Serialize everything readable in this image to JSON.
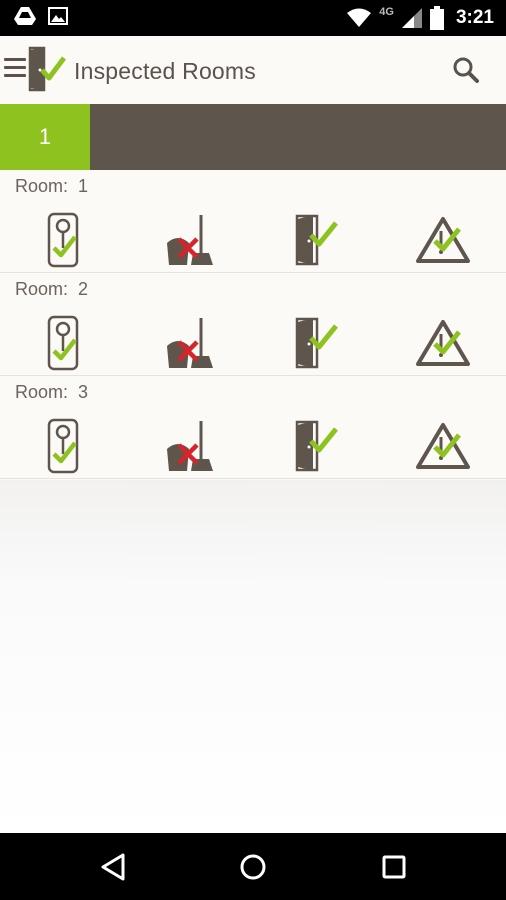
{
  "status_bar": {
    "time": "3:21",
    "network": "4G",
    "icons": [
      "drive-icon",
      "image-icon",
      "wifi-icon",
      "signal-icon",
      "battery-icon"
    ]
  },
  "app_bar": {
    "title": "Inspected Rooms",
    "icons": [
      "menu-icon",
      "inspected-rooms-logo-icon",
      "search-icon"
    ]
  },
  "tabs": [
    {
      "label": "1",
      "active": true
    }
  ],
  "room_label_prefix": "Room:",
  "rooms": [
    {
      "number": "1",
      "statuses": [
        "door-hanger-check",
        "cleaning-x",
        "door-check",
        "hazard-check"
      ]
    },
    {
      "number": "2",
      "statuses": [
        "door-hanger-check",
        "cleaning-x",
        "door-check",
        "hazard-check"
      ]
    },
    {
      "number": "3",
      "statuses": [
        "door-hanger-check",
        "cleaning-x",
        "door-check",
        "hazard-check"
      ]
    }
  ],
  "colors": {
    "accent_green": "#8dc21f",
    "tab_bar": "#5e554d",
    "icon_brown": "#5e554d",
    "error_red": "#d6252a"
  },
  "nav_bar": {
    "icons": [
      "back-icon",
      "home-icon",
      "recents-icon"
    ]
  }
}
